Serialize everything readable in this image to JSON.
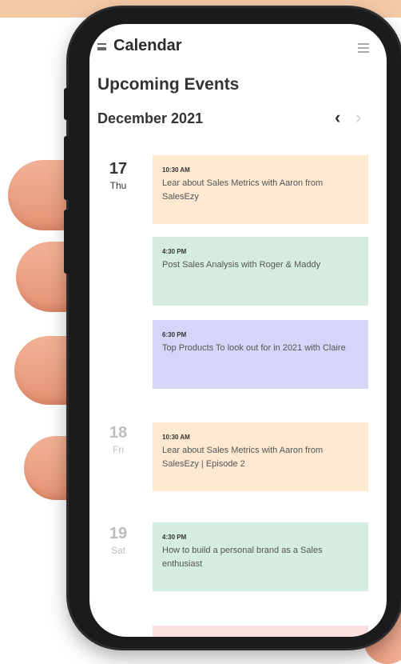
{
  "header": {
    "title": "Calendar"
  },
  "section_title": "Upcoming Events",
  "month": "December 2021",
  "nav": {
    "prev": "‹",
    "next": "›"
  },
  "days": [
    {
      "num": "17",
      "weekday": "Thu"
    },
    {
      "num": "18",
      "weekday": "Fri"
    },
    {
      "num": "19",
      "weekday": "Sat"
    }
  ],
  "events": [
    {
      "time": "10:30 AM",
      "title": "Lear about Sales Metrics with Aaron from SalesEzy",
      "color": "#fde9d1"
    },
    {
      "time": "4:30 PM",
      "title": "Post Sales Analysis with Roger & Maddy",
      "color": "#d5eddf"
    },
    {
      "time": "6:30 PM",
      "title": "Top Products To look out for in 2021 with Claire",
      "color": "#d6d5f7"
    },
    {
      "time": "10:30 AM",
      "title": "Lear about Sales Metrics with Aaron from SalesEzy | Episode 2",
      "color": "#fde9d1"
    },
    {
      "time": "4:30 PM",
      "title": "How to build a personal brand as a Sales enthusiast",
      "color": "#d5eddf"
    }
  ],
  "colors": {
    "accent_text": "#2b2b2b",
    "muted_day": "#bdbdbd"
  }
}
